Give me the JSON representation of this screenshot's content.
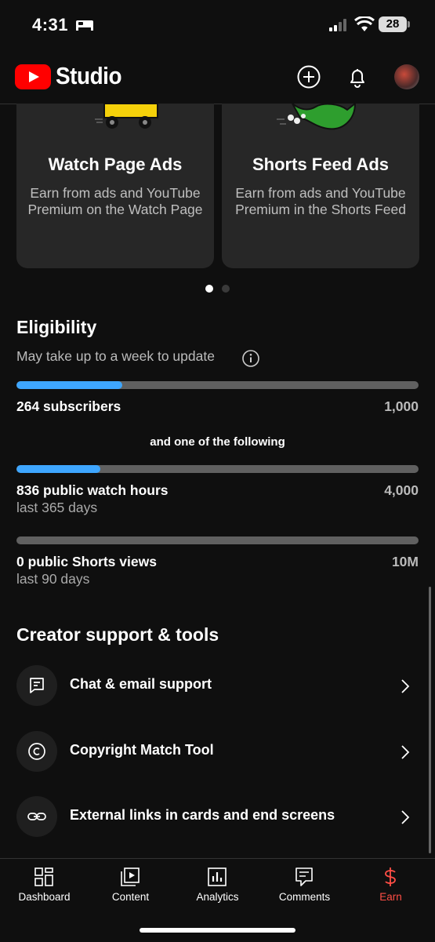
{
  "status_bar": {
    "time": "4:31",
    "battery": "28"
  },
  "header": {
    "brand": "Studio",
    "icons": [
      "create-icon",
      "notifications-icon",
      "avatar"
    ]
  },
  "cards": [
    {
      "title": "Watch Page Ads",
      "description": "Earn from ads and YouTube Premium on the Watch Page"
    },
    {
      "title": "Shorts Feed Ads",
      "description": "Earn from ads and YouTube Premium in the Shorts Feed"
    }
  ],
  "carousel": {
    "page": 1,
    "pages": 2
  },
  "eligibility": {
    "title": "Eligibility",
    "subtitle": "May take up to a week to update",
    "subscribers": {
      "label": "264 subscribers",
      "target": "1,000",
      "progress": 0.264
    },
    "separator": "and one of the following",
    "watch_hours": {
      "label": "836 public watch hours",
      "period": "last 365 days",
      "target": "4,000",
      "progress": 0.209
    },
    "shorts_views": {
      "label": "0 public Shorts views",
      "period": "last 90 days",
      "target": "10M",
      "progress": 0
    }
  },
  "tools": {
    "title": "Creator support & tools",
    "items": [
      {
        "label": "Chat & email support",
        "icon": "chat-icon"
      },
      {
        "label": "Copyright Match Tool",
        "icon": "copyright-icon"
      },
      {
        "label": "External links in cards and end screens",
        "icon": "link-icon"
      }
    ]
  },
  "bottom_nav": {
    "items": [
      {
        "label": "Dashboard",
        "icon": "dashboard-icon"
      },
      {
        "label": "Content",
        "icon": "content-icon"
      },
      {
        "label": "Analytics",
        "icon": "analytics-icon"
      },
      {
        "label": "Comments",
        "icon": "comments-icon"
      },
      {
        "label": "Earn",
        "icon": "earn-icon"
      }
    ],
    "active": "Earn",
    "active_color": "#ff4e45"
  },
  "colors": {
    "progress": "#3ea6ff",
    "track": "#606060",
    "brand_red": "#ff0000"
  }
}
